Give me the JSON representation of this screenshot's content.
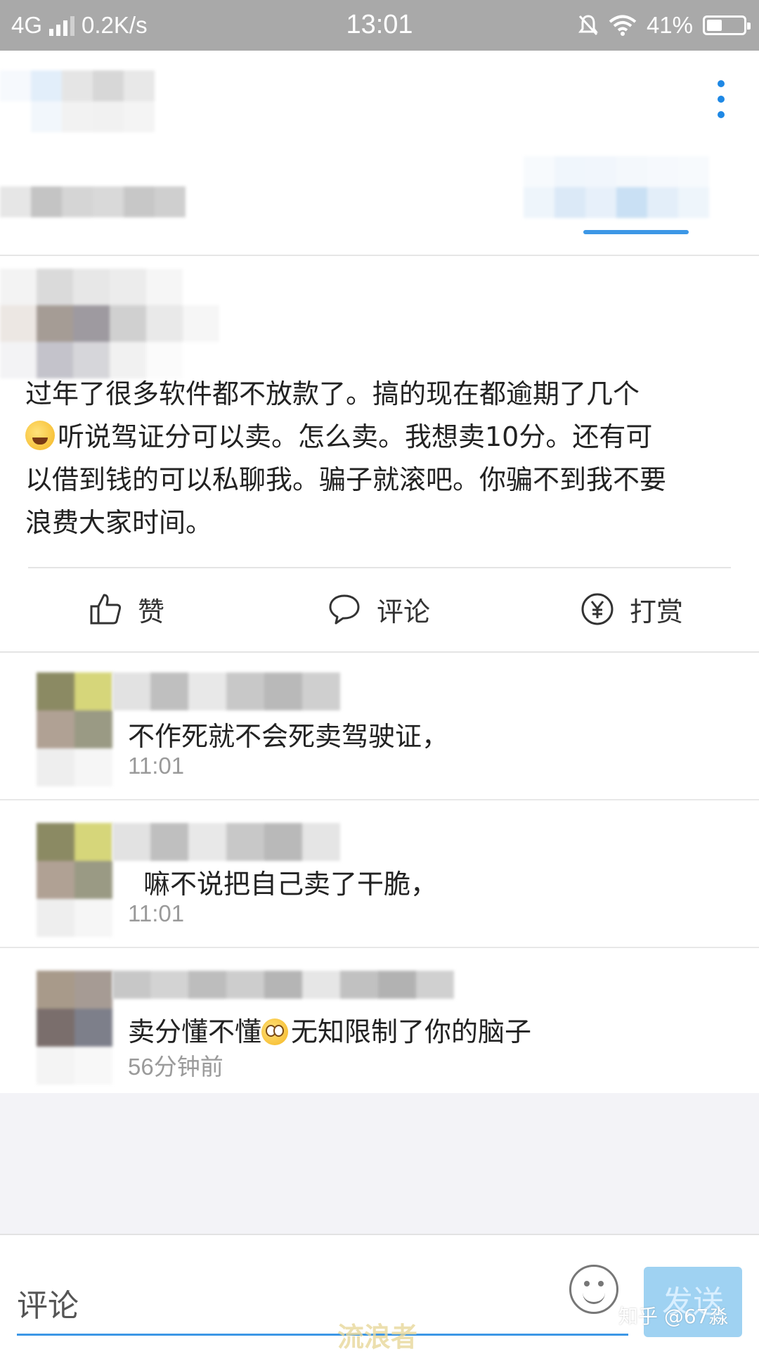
{
  "status_bar": {
    "network": "4G",
    "speed": "0.2K/s",
    "time": "13:01",
    "battery": "41%",
    "battery_level": 0.41
  },
  "post": {
    "line1": "过年了很多软件都不放款了。搞的现在都逾期了几个",
    "line2": "听说驾证分可以卖。怎么卖。我想卖10分。还有可",
    "line3": "以借到钱的可以私聊我。骗子就滚吧。你骗不到我不要",
    "line4": "浪费大家时间。"
  },
  "actions": {
    "like": "赞",
    "comment": "评论",
    "reward": "打赏"
  },
  "comments": [
    {
      "text": "不作死就不会死卖驾驶证，",
      "time": "11:01"
    },
    {
      "text": "嘛不说把自己卖了干脆，",
      "time": "11:01"
    },
    {
      "text_before": "卖分懂不懂",
      "text_after": "无知限制了你的脑子",
      "time": "56分钟前"
    }
  ],
  "bottom_bar": {
    "placeholder": "评论",
    "send": "发送"
  },
  "watermark": {
    "zhihu": "知乎 @67淼",
    "site": "流浪者"
  },
  "colors": {
    "accent": "#3c97e6",
    "status_bar": "#a9a9a9",
    "send_button": "#9fd2f2"
  }
}
